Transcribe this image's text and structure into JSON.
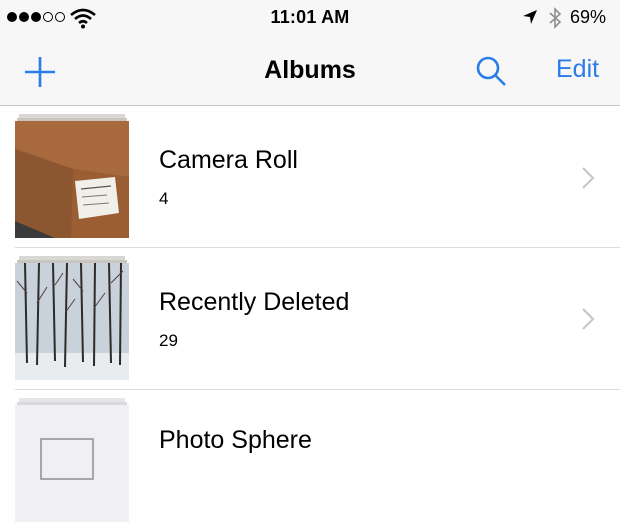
{
  "status_bar": {
    "time": "11:01 AM",
    "battery": "69%",
    "signal_bars": 3,
    "signal_total": 5
  },
  "nav": {
    "title": "Albums",
    "edit_label": "Edit",
    "accent_color": "#2a7ce8"
  },
  "albums": [
    {
      "name": "Camera Roll",
      "count": "4"
    },
    {
      "name": "Recently Deleted",
      "count": "29"
    },
    {
      "name": "Photo Sphere",
      "count": ""
    }
  ],
  "icons": [
    "wifi-icon",
    "location-arrow-icon",
    "bluetooth-icon",
    "plus-icon",
    "search-icon",
    "chevron-right-icon"
  ]
}
